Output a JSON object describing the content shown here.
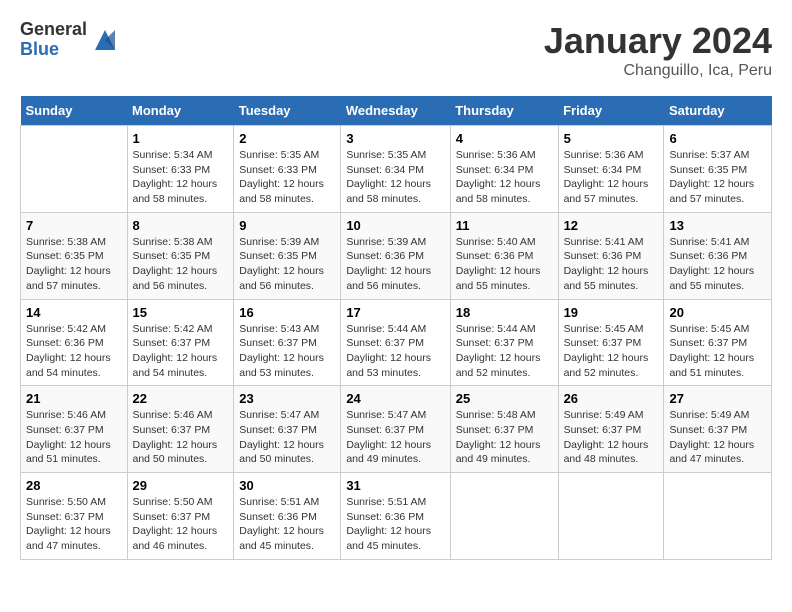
{
  "header": {
    "logo_general": "General",
    "logo_blue": "Blue",
    "month_title": "January 2024",
    "subtitle": "Changuillo, Ica, Peru"
  },
  "calendar": {
    "weekdays": [
      "Sunday",
      "Monday",
      "Tuesday",
      "Wednesday",
      "Thursday",
      "Friday",
      "Saturday"
    ],
    "weeks": [
      [
        {
          "day": "",
          "info": ""
        },
        {
          "day": "1",
          "info": "Sunrise: 5:34 AM\nSunset: 6:33 PM\nDaylight: 12 hours\nand 58 minutes."
        },
        {
          "day": "2",
          "info": "Sunrise: 5:35 AM\nSunset: 6:33 PM\nDaylight: 12 hours\nand 58 minutes."
        },
        {
          "day": "3",
          "info": "Sunrise: 5:35 AM\nSunset: 6:34 PM\nDaylight: 12 hours\nand 58 minutes."
        },
        {
          "day": "4",
          "info": "Sunrise: 5:36 AM\nSunset: 6:34 PM\nDaylight: 12 hours\nand 58 minutes."
        },
        {
          "day": "5",
          "info": "Sunrise: 5:36 AM\nSunset: 6:34 PM\nDaylight: 12 hours\nand 57 minutes."
        },
        {
          "day": "6",
          "info": "Sunrise: 5:37 AM\nSunset: 6:35 PM\nDaylight: 12 hours\nand 57 minutes."
        }
      ],
      [
        {
          "day": "7",
          "info": "Sunrise: 5:38 AM\nSunset: 6:35 PM\nDaylight: 12 hours\nand 57 minutes."
        },
        {
          "day": "8",
          "info": "Sunrise: 5:38 AM\nSunset: 6:35 PM\nDaylight: 12 hours\nand 56 minutes."
        },
        {
          "day": "9",
          "info": "Sunrise: 5:39 AM\nSunset: 6:35 PM\nDaylight: 12 hours\nand 56 minutes."
        },
        {
          "day": "10",
          "info": "Sunrise: 5:39 AM\nSunset: 6:36 PM\nDaylight: 12 hours\nand 56 minutes."
        },
        {
          "day": "11",
          "info": "Sunrise: 5:40 AM\nSunset: 6:36 PM\nDaylight: 12 hours\nand 55 minutes."
        },
        {
          "day": "12",
          "info": "Sunrise: 5:41 AM\nSunset: 6:36 PM\nDaylight: 12 hours\nand 55 minutes."
        },
        {
          "day": "13",
          "info": "Sunrise: 5:41 AM\nSunset: 6:36 PM\nDaylight: 12 hours\nand 55 minutes."
        }
      ],
      [
        {
          "day": "14",
          "info": "Sunrise: 5:42 AM\nSunset: 6:36 PM\nDaylight: 12 hours\nand 54 minutes."
        },
        {
          "day": "15",
          "info": "Sunrise: 5:42 AM\nSunset: 6:37 PM\nDaylight: 12 hours\nand 54 minutes."
        },
        {
          "day": "16",
          "info": "Sunrise: 5:43 AM\nSunset: 6:37 PM\nDaylight: 12 hours\nand 53 minutes."
        },
        {
          "day": "17",
          "info": "Sunrise: 5:44 AM\nSunset: 6:37 PM\nDaylight: 12 hours\nand 53 minutes."
        },
        {
          "day": "18",
          "info": "Sunrise: 5:44 AM\nSunset: 6:37 PM\nDaylight: 12 hours\nand 52 minutes."
        },
        {
          "day": "19",
          "info": "Sunrise: 5:45 AM\nSunset: 6:37 PM\nDaylight: 12 hours\nand 52 minutes."
        },
        {
          "day": "20",
          "info": "Sunrise: 5:45 AM\nSunset: 6:37 PM\nDaylight: 12 hours\nand 51 minutes."
        }
      ],
      [
        {
          "day": "21",
          "info": "Sunrise: 5:46 AM\nSunset: 6:37 PM\nDaylight: 12 hours\nand 51 minutes."
        },
        {
          "day": "22",
          "info": "Sunrise: 5:46 AM\nSunset: 6:37 PM\nDaylight: 12 hours\nand 50 minutes."
        },
        {
          "day": "23",
          "info": "Sunrise: 5:47 AM\nSunset: 6:37 PM\nDaylight: 12 hours\nand 50 minutes."
        },
        {
          "day": "24",
          "info": "Sunrise: 5:47 AM\nSunset: 6:37 PM\nDaylight: 12 hours\nand 49 minutes."
        },
        {
          "day": "25",
          "info": "Sunrise: 5:48 AM\nSunset: 6:37 PM\nDaylight: 12 hours\nand 49 minutes."
        },
        {
          "day": "26",
          "info": "Sunrise: 5:49 AM\nSunset: 6:37 PM\nDaylight: 12 hours\nand 48 minutes."
        },
        {
          "day": "27",
          "info": "Sunrise: 5:49 AM\nSunset: 6:37 PM\nDaylight: 12 hours\nand 47 minutes."
        }
      ],
      [
        {
          "day": "28",
          "info": "Sunrise: 5:50 AM\nSunset: 6:37 PM\nDaylight: 12 hours\nand 47 minutes."
        },
        {
          "day": "29",
          "info": "Sunrise: 5:50 AM\nSunset: 6:37 PM\nDaylight: 12 hours\nand 46 minutes."
        },
        {
          "day": "30",
          "info": "Sunrise: 5:51 AM\nSunset: 6:36 PM\nDaylight: 12 hours\nand 45 minutes."
        },
        {
          "day": "31",
          "info": "Sunrise: 5:51 AM\nSunset: 6:36 PM\nDaylight: 12 hours\nand 45 minutes."
        },
        {
          "day": "",
          "info": ""
        },
        {
          "day": "",
          "info": ""
        },
        {
          "day": "",
          "info": ""
        }
      ]
    ]
  }
}
